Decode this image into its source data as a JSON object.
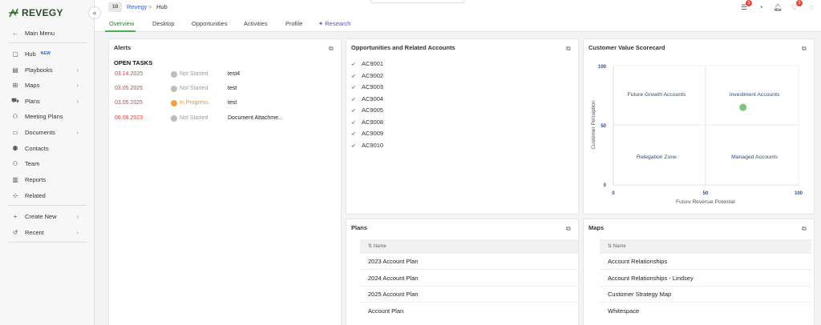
{
  "brand": {
    "name": "REVEGY"
  },
  "sidebar": {
    "items": [
      {
        "label": "Main Menu",
        "icon": "arrow-left-icon"
      },
      {
        "label": "Hub",
        "badge": "NEW",
        "icon": "hub-icon"
      },
      {
        "label": "Playbooks",
        "icon": "playbook-icon"
      },
      {
        "label": "Maps",
        "icon": "map-icon"
      },
      {
        "label": "Plans",
        "icon": "plans-icon"
      },
      {
        "label": "Meeting Plans",
        "icon": "meeting-icon"
      },
      {
        "label": "Documents",
        "icon": "document-icon"
      },
      {
        "label": "Contacts",
        "icon": "contacts-icon"
      },
      {
        "label": "Team",
        "icon": "team-icon"
      },
      {
        "label": "Reports",
        "icon": "reports-icon"
      },
      {
        "label": "Related",
        "icon": "related-icon"
      },
      {
        "label": "Create New",
        "icon": "plus-icon"
      },
      {
        "label": "Recent",
        "icon": "history-icon"
      }
    ],
    "collapse_glyph": "«"
  },
  "breadcrumb": {
    "number": "10",
    "parent": "Revegy",
    "separator": ">",
    "current": "Hub"
  },
  "notifications": {
    "tasks_count": "3",
    "alerts_count": "2"
  },
  "tabs": [
    "Overview",
    "Desktop",
    "Opportunities",
    "Activities",
    "Profile",
    "Research"
  ],
  "alerts": {
    "title": "Alerts",
    "subtitle": "OPEN TASKS",
    "tasks": [
      {
        "date": "03.14.2025",
        "status": "Not Started",
        "name": "test4"
      },
      {
        "date": "03.05.2025",
        "status": "Not Started",
        "name": "test"
      },
      {
        "date": "03.05.2025",
        "status": "In Progress",
        "name": "test"
      },
      {
        "date": "08.08.2023",
        "status": "Not Started",
        "name": "Document Attachme..."
      }
    ]
  },
  "opportunities": {
    "title": "Opportunities and Related Accounts",
    "items": [
      "AC9001",
      "AC9002",
      "AC9003",
      "AC9004",
      "AC9005",
      "AC9008",
      "AC9009",
      "AC9010"
    ]
  },
  "scorecard": {
    "title": "Customer Value Scorecard",
    "quadrants": [
      "Future Growth Accounts",
      "Investment Accounts",
      "Relegation Zone",
      "Managed Accounts"
    ],
    "xlabel": "Future Revenue Potential",
    "ylabel": "Customer Perception",
    "xticks": [
      "0",
      "50",
      "100"
    ],
    "yticks": [
      "100",
      "50",
      "0"
    ],
    "point": {
      "x": 70,
      "y": 65
    },
    "point_color": "#7cc57a"
  },
  "plans": {
    "title": "Plans",
    "column": "Name",
    "rows": [
      "2023 Account Plan",
      "2024 Account Plan",
      "2025 Account Plan",
      "Account Plan"
    ]
  },
  "maps": {
    "title": "Maps",
    "column": "Name",
    "rows": [
      "Account Relationships",
      "Account Relationships - Lindsey",
      "Customer Strategy Map",
      "Whitespace"
    ]
  },
  "colors": {
    "accent": "#4caf50",
    "link": "#3a62c4",
    "overdue": "#e53935",
    "in_progress": "#f0902c",
    "research": "#5c4fd6"
  }
}
